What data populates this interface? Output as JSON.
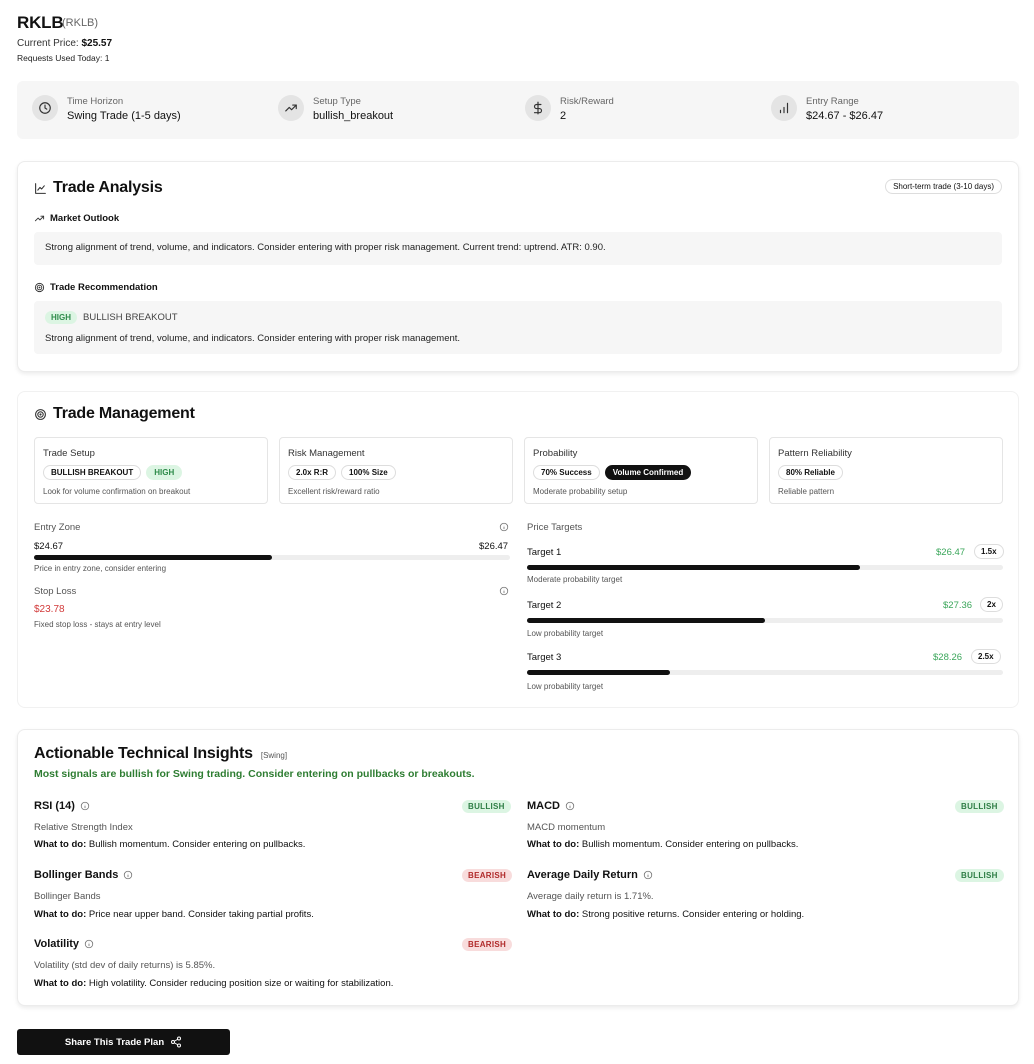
{
  "header": {
    "symbol": "RKLB",
    "symbol_sub": "(RKLB)",
    "current_price_label": "Current Price:",
    "current_price": "$25.57",
    "requests_label": "Requests Used Today: 1"
  },
  "summary": [
    {
      "icon": "clock-icon",
      "label": "Time Horizon",
      "value": "Swing Trade (1-5 days)"
    },
    {
      "icon": "trending-up-icon",
      "label": "Setup Type",
      "value": "bullish_breakout"
    },
    {
      "icon": "dollar-icon",
      "label": "Risk/Reward",
      "value": "2"
    },
    {
      "icon": "bar-chart-icon",
      "label": "Entry Range",
      "value": "$24.67 - $26.47"
    }
  ],
  "analysis": {
    "title": "Trade Analysis",
    "badge": "Short-term trade (3-10 days)",
    "outlook_title": "Market Outlook",
    "outlook_text": "Strong alignment of trend, volume, and indicators. Consider entering with proper risk management. Current trend: uptrend. ATR: 0.90.",
    "rec_title": "Trade Recommendation",
    "rec_badge": "HIGH",
    "rec_type": "BULLISH BREAKOUT",
    "rec_text": "Strong alignment of trend, volume, and indicators. Consider entering with proper risk management."
  },
  "management": {
    "title": "Trade Management",
    "boxes": [
      {
        "title": "Trade Setup",
        "chips": [
          "BULLISH BREAKOUT",
          "HIGH"
        ],
        "desc": "Look for volume confirmation on breakout"
      },
      {
        "title": "Risk Management",
        "chips": [
          "2.0x R:R",
          "100% Size"
        ],
        "desc": "Excellent risk/reward ratio"
      },
      {
        "title": "Probability",
        "chips": [
          "70% Success",
          "Volume Confirmed"
        ],
        "desc": "Moderate probability setup"
      },
      {
        "title": "Pattern Reliability",
        "chips": [
          "80% Reliable"
        ],
        "desc": "Reliable pattern"
      }
    ],
    "entry": {
      "label": "Entry Zone",
      "low": "$24.67",
      "high": "$26.47",
      "note": "Price in entry zone, consider entering",
      "fill_pct": 50
    },
    "stop": {
      "label": "Stop Loss",
      "value": "$23.78",
      "note": "Fixed stop loss - stays at entry level"
    },
    "targets_label": "Price Targets",
    "targets": [
      {
        "label": "Target 1",
        "price": "$26.47",
        "mult": "1.5x",
        "note": "Moderate probability target",
        "fill_pct": 70
      },
      {
        "label": "Target 2",
        "price": "$27.36",
        "mult": "2x",
        "note": "Low probability target",
        "fill_pct": 50
      },
      {
        "label": "Target 3",
        "price": "$28.26",
        "mult": "2.5x",
        "note": "Low probability target",
        "fill_pct": 30
      }
    ]
  },
  "insights": {
    "title": "Actionable Technical Insights",
    "tag": "[Swing]",
    "summary": "Most signals are bullish for Swing trading. Consider entering on pullbacks or breakouts.",
    "do_label": "What to do:",
    "indicators": [
      {
        "name": "RSI (14)",
        "signal": "BULLISH",
        "desc": "Relative Strength Index",
        "action": "Bullish momentum. Consider entering on pullbacks."
      },
      {
        "name": "MACD",
        "signal": "BULLISH",
        "desc": "MACD momentum",
        "action": "Bullish momentum. Consider entering on pullbacks."
      },
      {
        "name": "Bollinger Bands",
        "signal": "BEARISH",
        "desc": "Bollinger Bands",
        "action": "Price near upper band. Consider taking partial profits."
      },
      {
        "name": "Average Daily Return",
        "signal": "BULLISH",
        "desc": "Average daily return is 1.71%.",
        "action": "Strong positive returns. Consider entering or holding."
      },
      {
        "name": "Volatility",
        "signal": "BEARISH",
        "desc": "Volatility (std dev of daily returns) is 5.85%.",
        "action": "High volatility. Consider reducing position size or waiting for stabilization."
      }
    ]
  },
  "share_button": "Share This Trade Plan",
  "colors": {
    "bullish": "#3aa65a",
    "bearish": "#d23a3a",
    "accent": "#111111"
  }
}
